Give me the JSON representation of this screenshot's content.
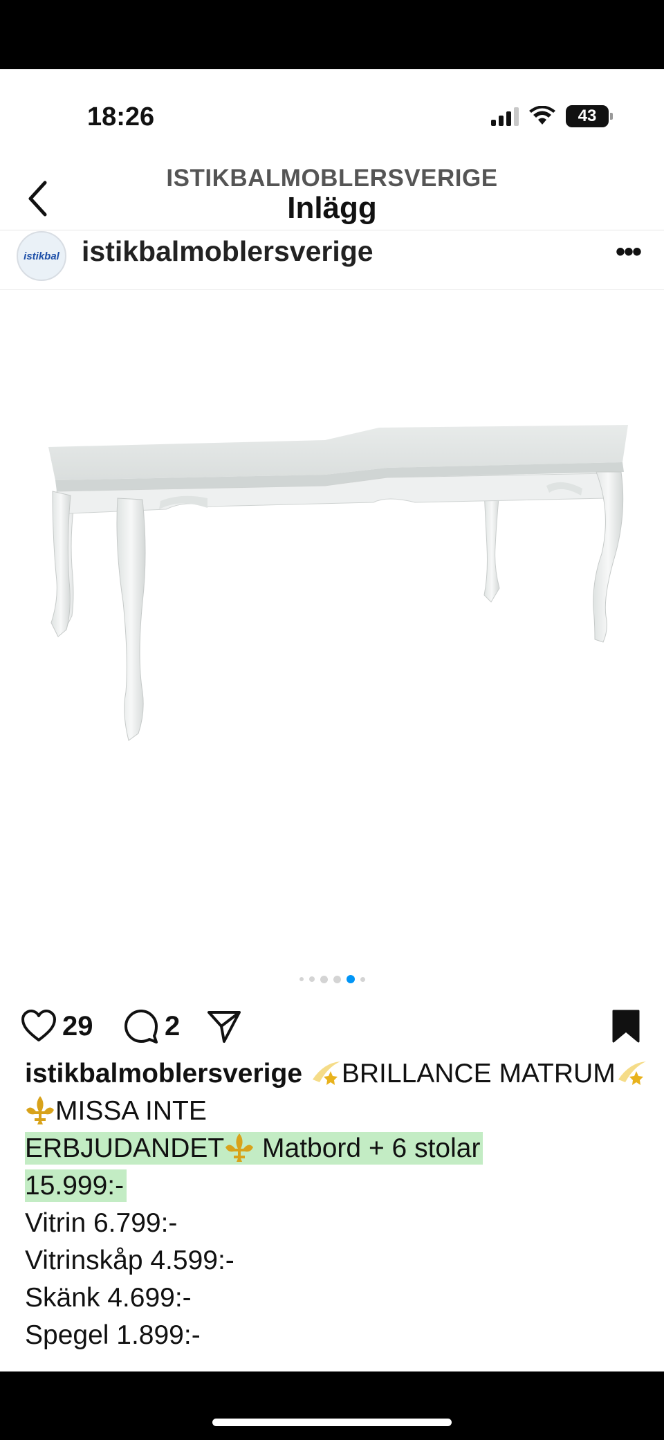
{
  "status_bar": {
    "time": "18:26",
    "battery": "43",
    "signal_icon": "cellular-signal-icon",
    "wifi_icon": "wifi-icon"
  },
  "header": {
    "account": "ISTIKBALMOBLERSVERIGE",
    "title": "Inlägg",
    "back_icon": "chevron-left-icon"
  },
  "post": {
    "username": "istikbalmoblersverige",
    "avatar_text": "istikbal",
    "more_label": "•••",
    "image_alt": "white extendable dining table with curved legs",
    "carousel": {
      "total": 6,
      "active": 5
    },
    "likes": "29",
    "comments": "2",
    "caption": {
      "user": "istikbalmoblersverige",
      "part1": "BRILLANCE MATRUM",
      "part2": "MISSA INTE",
      "part3": "ERBJUDANDET",
      "part4": " Matbord + 6 stolar",
      "price_main": "15.999:-",
      "lines": [
        "Vitrin 6.799:-",
        "Vitrinskåp 4.599:-",
        "Skänk 4.699:-",
        "Spegel 1.899:-"
      ]
    }
  },
  "colors": {
    "highlight": "#c3ecc4",
    "accent_dot": "#0095f6",
    "emoji_gold": "#d8a21a"
  }
}
